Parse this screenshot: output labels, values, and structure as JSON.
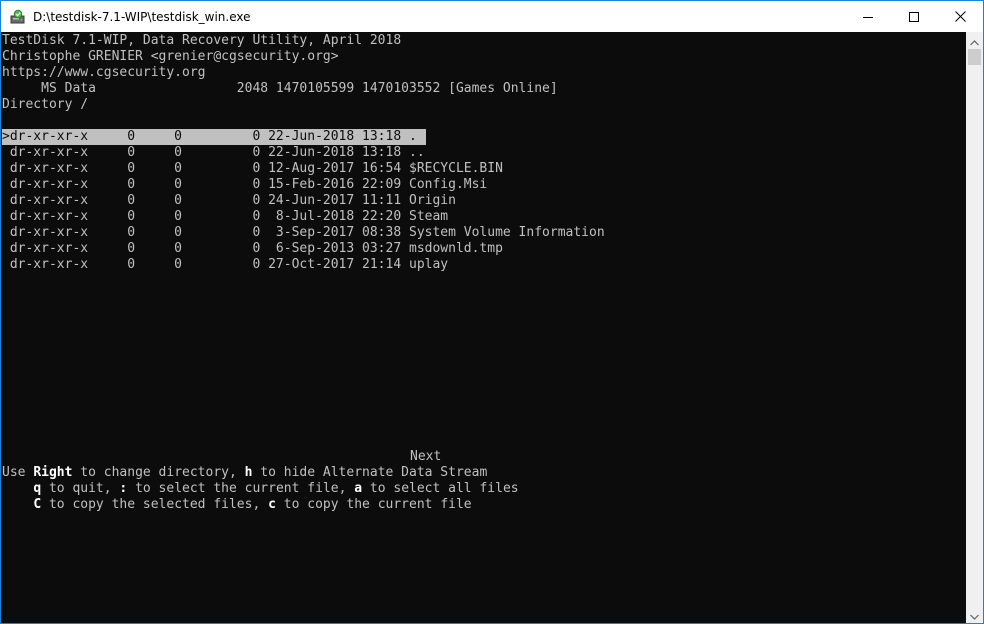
{
  "window": {
    "title": "D:\\testdisk-7.1-WIP\\testdisk_win.exe",
    "icons": {
      "app": "testdisk-app-icon",
      "minimize": "minimize-icon",
      "maximize": "maximize-icon",
      "close": "close-icon"
    }
  },
  "header": {
    "line1": "TestDisk 7.1-WIP, Data Recovery Utility, April 2018",
    "line2": "Christophe GRENIER <grenier@cgsecurity.org>",
    "line3": "https://www.cgsecurity.org",
    "line4": "     MS Data                  2048 1470105599 1470103552 [Games Online]",
    "line5": "Directory /"
  },
  "files": [
    {
      "text": ">dr-xr-xr-x     0     0         0 22-Jun-2018 13:18 ."
    },
    {
      "text": " dr-xr-xr-x     0     0         0 22-Jun-2018 13:18 .."
    },
    {
      "text": " dr-xr-xr-x     0     0         0 12-Aug-2017 16:54 $RECYCLE.BIN"
    },
    {
      "text": " dr-xr-xr-x     0     0         0 15-Feb-2016 22:09 Config.Msi"
    },
    {
      "text": " dr-xr-xr-x     0     0         0 24-Jun-2017 11:11 Origin"
    },
    {
      "text": " dr-xr-xr-x     0     0         0  8-Jul-2018 22:20 Steam"
    },
    {
      "text": " dr-xr-xr-x     0     0         0  3-Sep-2017 08:38 System Volume Information"
    },
    {
      "text": " dr-xr-xr-x     0     0         0  6-Sep-2013 03:27 msdownld.tmp"
    },
    {
      "text": " dr-xr-xr-x     0     0         0 27-Oct-2017 21:14 uplay"
    }
  ],
  "footer": {
    "next": "Next",
    "help1": {
      "pre": "Use ",
      "key1": "Right",
      "mid": " to change directory, ",
      "key2": "h",
      "post": " to hide Alternate Data Stream"
    },
    "help2": {
      "pre": "    ",
      "key1": "q",
      "mid1": " to quit, ",
      "key2": ":",
      "mid2": " to select the current file, ",
      "key3": "a",
      "post": " to select all files"
    },
    "help3": {
      "pre": "    ",
      "key1": "C",
      "mid1": " to copy the selected files, ",
      "key2": "c",
      "post": " to copy the current file"
    }
  },
  "scrollbar": {
    "icons": {
      "up": "scroll-up-arrow-icon",
      "down": "scroll-down-arrow-icon"
    }
  },
  "colors": {
    "console_bg": "#0c0c0c",
    "console_fg": "#c0c0c0",
    "highlight_fg": "#ffffff",
    "window_border": "#1883d7"
  }
}
